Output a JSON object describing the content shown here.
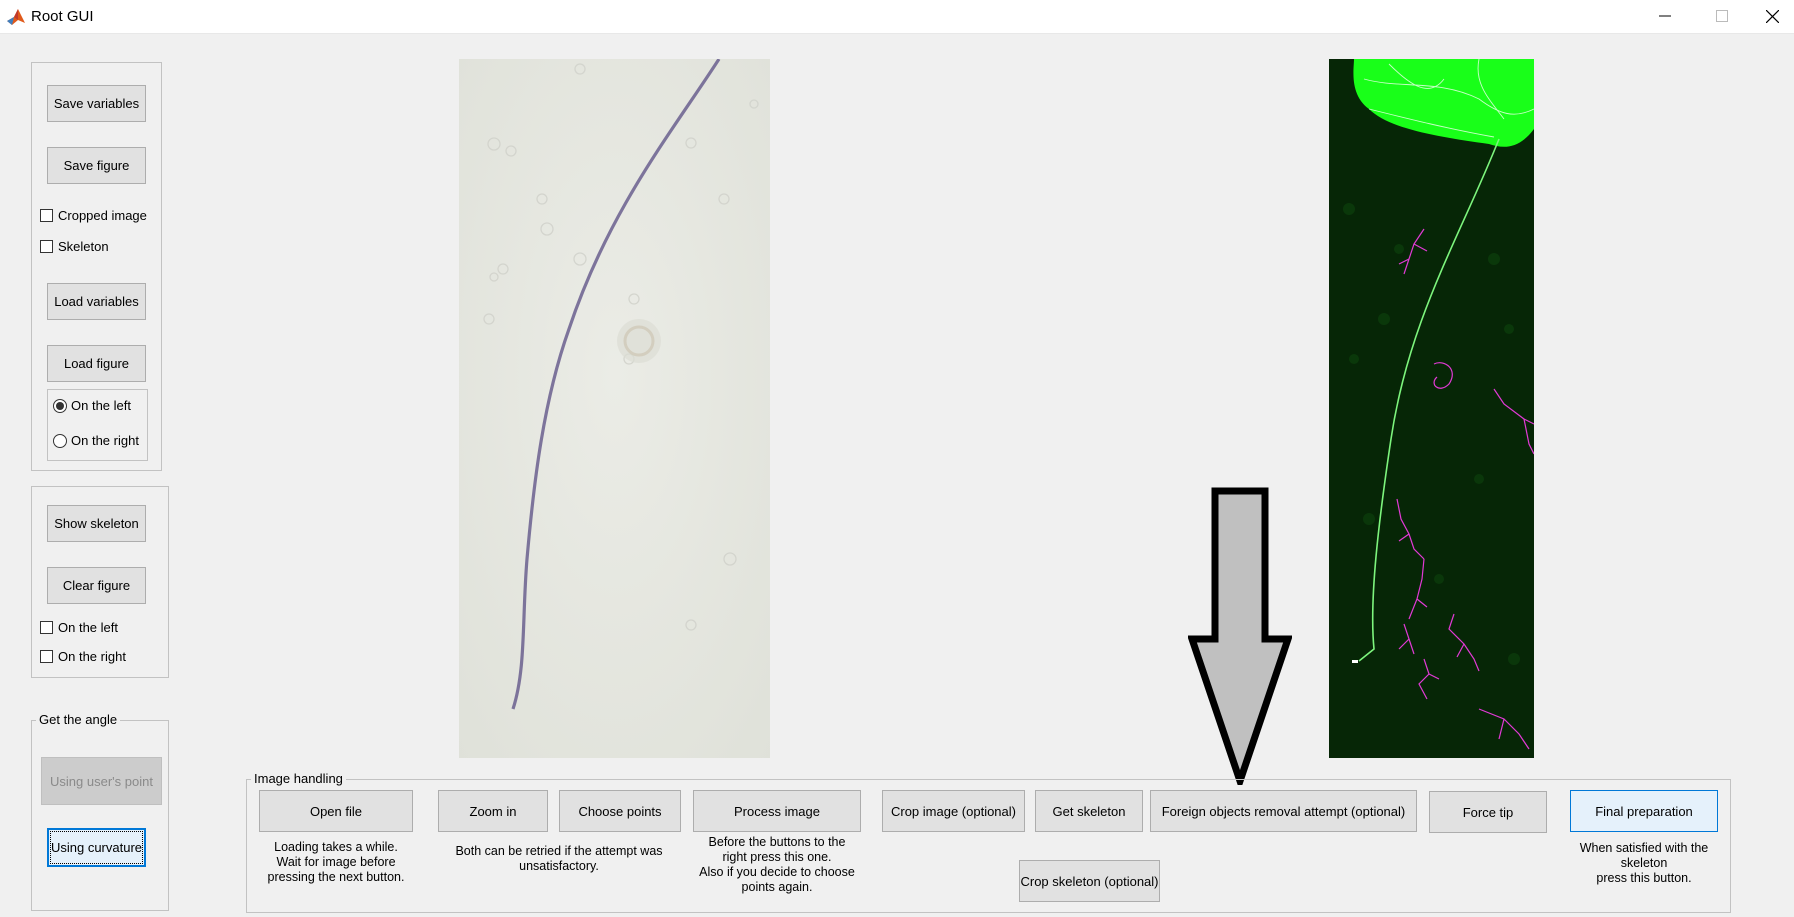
{
  "window": {
    "title": "Root GUI"
  },
  "sidebar": {
    "save_variables": "Save variables",
    "save_figure": "Save figure",
    "cropped_image": "Cropped image",
    "skeleton": "Skeleton",
    "load_variables": "Load variables",
    "load_figure": "Load figure",
    "on_the_left": "On the left",
    "on_the_right": "On the right",
    "show_skeleton": "Show skeleton",
    "clear_figure": "Clear figure",
    "show_on_left": "On the left",
    "show_on_right": "On the right",
    "angle_title": "Get the angle",
    "using_users_point": "Using user's point",
    "using_curvature": "Using curvature"
  },
  "image_handling": {
    "title": "Image handling",
    "open_file": "Open file",
    "open_file_hint": "Loading takes a while.\nWait for  image before\npressing the next button.",
    "zoom_in": "Zoom in",
    "choose_points": "Choose points",
    "points_hint": "Both can be retried if the attempt was\nunsatisfactory.",
    "process_image": "Process image",
    "process_hint": "Before the buttons to the\nright press this one.\nAlso if you decide to choose\npoints again.",
    "crop_image": "Crop image (optional)",
    "get_skeleton": "Get skeleton",
    "crop_skeleton": "Crop skeleton (optional)",
    "foreign_objects": "Foreign objects removal attempt (optional)",
    "force_tip": "Force tip",
    "final_preparation": "Final preparation",
    "final_hint": "When satisfied with the\nskeleton\npress this button."
  },
  "states": {
    "cropped_image_checked": false,
    "skeleton_checked": false,
    "load_on_left_selected": true,
    "load_on_right_selected": false,
    "show_on_left_checked": false,
    "show_on_right_checked": false
  },
  "colors": {
    "window_bg": "#f0f0f0",
    "root_photo_bg": "#e6e7e0",
    "root_line": "#6a5f8e",
    "skeleton_bg": "#062606",
    "skeleton_green": "#19ff19",
    "skeleton_magenta": "#e23ad6",
    "focus_blue": "#0078d7"
  }
}
